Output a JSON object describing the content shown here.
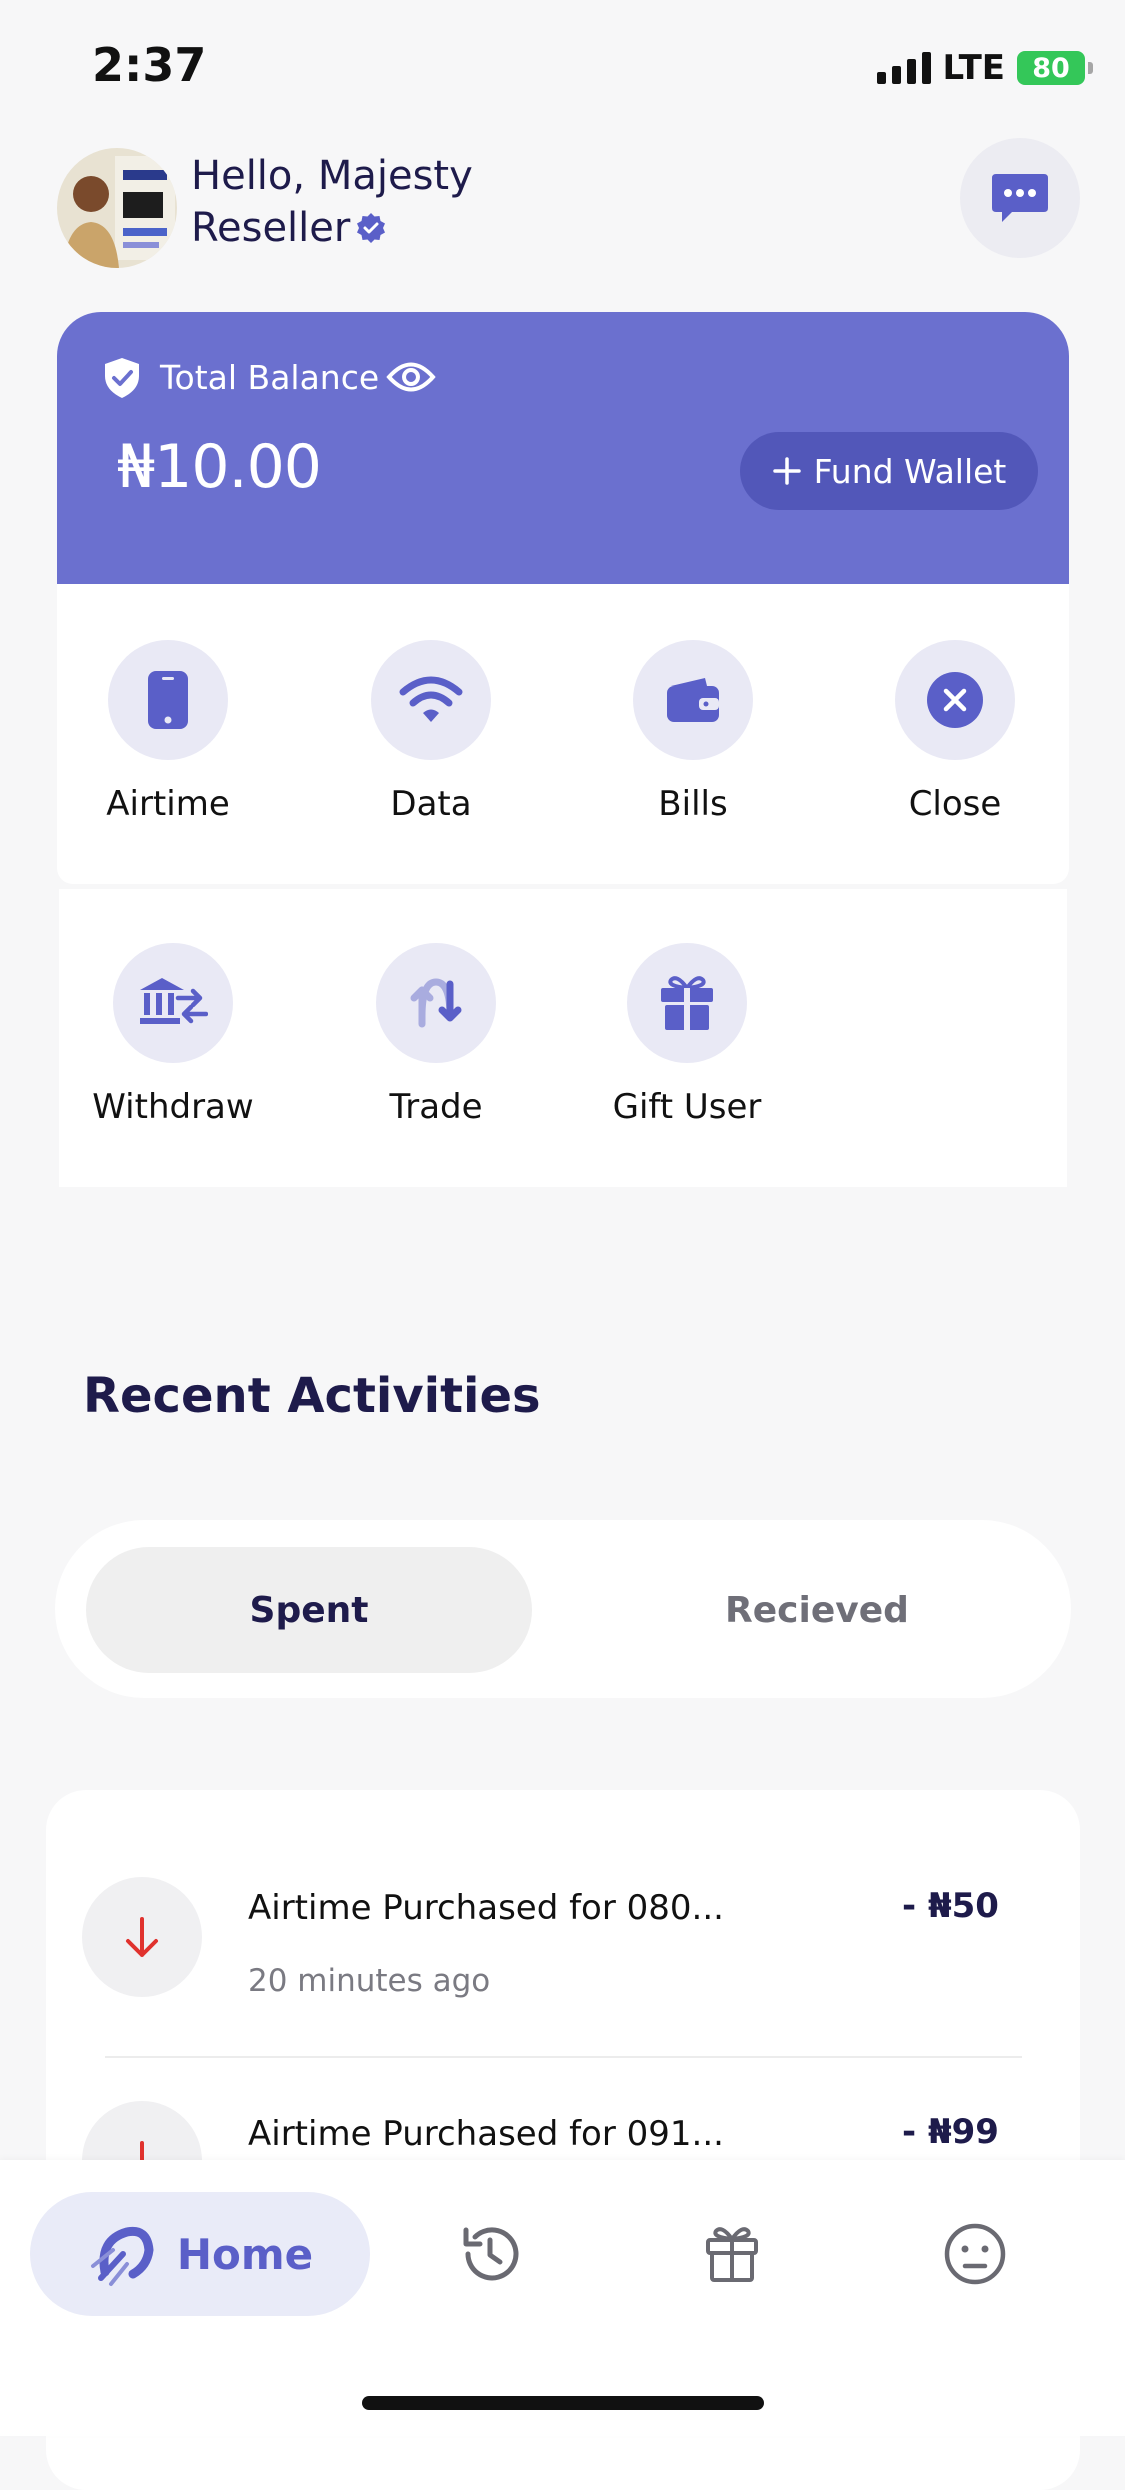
{
  "status_bar": {
    "time": "2:37",
    "network": "LTE",
    "battery": "80"
  },
  "header": {
    "greeting": "Hello, Majesty",
    "role": "Reseller"
  },
  "balance": {
    "label": "Total Balance",
    "amount": "₦10.00",
    "fund_button": "Fund Wallet"
  },
  "quick_actions": {
    "row1": [
      {
        "label": "Airtime",
        "icon": "phone-icon"
      },
      {
        "label": "Data",
        "icon": "wifi-icon"
      },
      {
        "label": "Bills",
        "icon": "wallet-icon"
      },
      {
        "label": "Close",
        "icon": "close-icon"
      }
    ],
    "row2": [
      {
        "label": "Withdraw",
        "icon": "bank-transfer-icon"
      },
      {
        "label": "Trade",
        "icon": "trade-icon"
      },
      {
        "label": "Gift User",
        "icon": "gift-icon"
      }
    ]
  },
  "recent": {
    "title": "Recent Activities",
    "tabs": {
      "spent": "Spent",
      "received": "Recieved"
    },
    "items": [
      {
        "title": "Airtime Purchased for 080...",
        "time": "20 minutes ago",
        "amount": "- ₦50"
      },
      {
        "title": "Airtime Purchased for 091...",
        "amount": "- ₦99"
      }
    ]
  },
  "nav": {
    "home": "Home",
    "icons": [
      "home-rocket-icon",
      "history-icon",
      "gift-icon",
      "profile-icon"
    ]
  },
  "colors": {
    "accent": "#6b70cf",
    "accent_dark": "#5257b9",
    "debit_arrow": "#e0322e"
  }
}
